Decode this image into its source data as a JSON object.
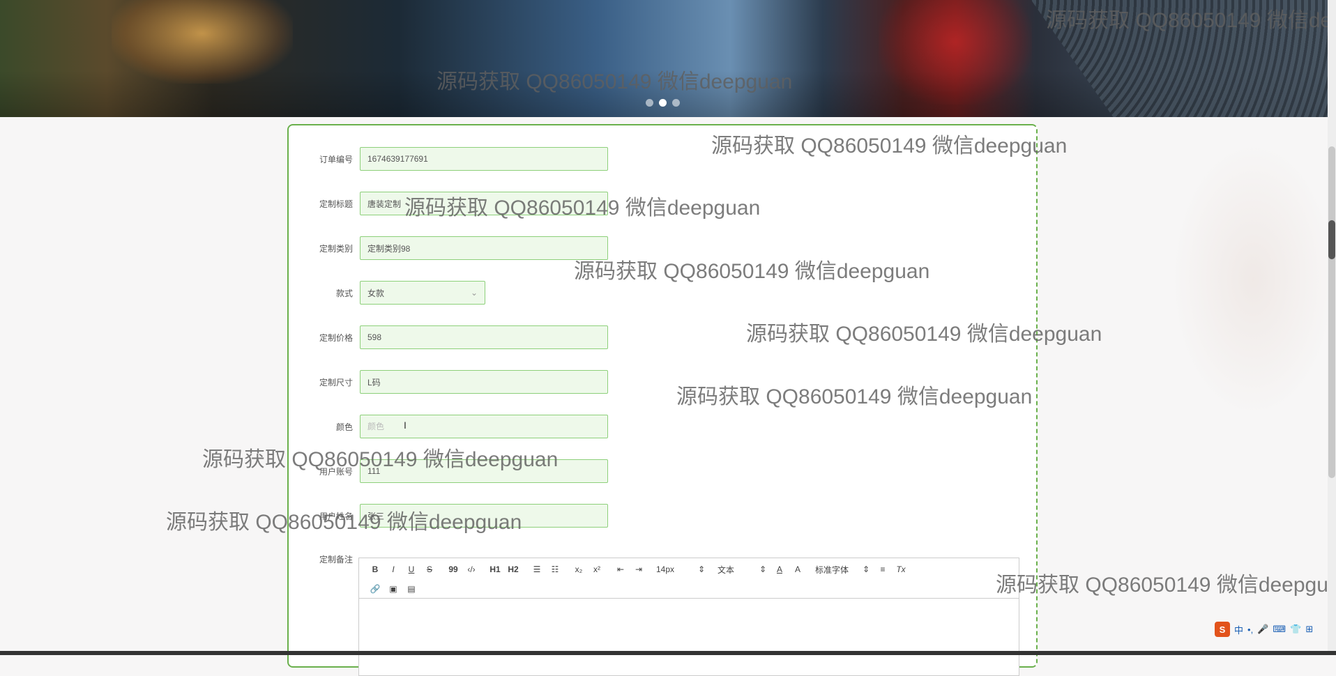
{
  "banner": {
    "carousel_dots": 3,
    "active_dot": 2
  },
  "form": {
    "order_no": {
      "label": "订单编号",
      "value": "1674639177691"
    },
    "title": {
      "label": "定制标题",
      "value": "唐装定制"
    },
    "category": {
      "label": "定制类别",
      "value": "定制类别98"
    },
    "style": {
      "label": "款式",
      "value": "女款"
    },
    "price": {
      "label": "定制价格",
      "value": "598"
    },
    "size": {
      "label": "定制尺寸",
      "value": "L码"
    },
    "color": {
      "label": "颜色",
      "value": "",
      "placeholder": "颜色"
    },
    "account": {
      "label": "用户账号",
      "value": "111"
    },
    "name": {
      "label": "用户姓名",
      "value": "张三"
    },
    "remark": {
      "label": "定制备注"
    }
  },
  "editor": {
    "toolbar": {
      "bold": "B",
      "italic": "I",
      "underline": "U",
      "strike": "S",
      "quote": "99",
      "code": "‹/›",
      "h1": "H1",
      "h2": "H2",
      "ordered_list": "☰",
      "bullet_list": "☷",
      "sub": "x₂",
      "sup": "x²",
      "outdent": "⇤",
      "indent": "⇥",
      "size": "14px",
      "header": "文本",
      "color": "A",
      "background": "A",
      "font": "标准字体",
      "align": "≡",
      "clean": "Tx",
      "link": "🔗",
      "image": "▣",
      "video": "▤"
    }
  },
  "watermark": "源码获取 QQ86050149 微信deepguan",
  "ime": {
    "logo": "S",
    "items": [
      "中",
      "•,",
      "🎤",
      "⌨",
      "👕",
      "⊞"
    ]
  },
  "colors": {
    "border": "#6ab04c",
    "field_bg": "#eef9ea",
    "field_border": "#8dd07a"
  }
}
